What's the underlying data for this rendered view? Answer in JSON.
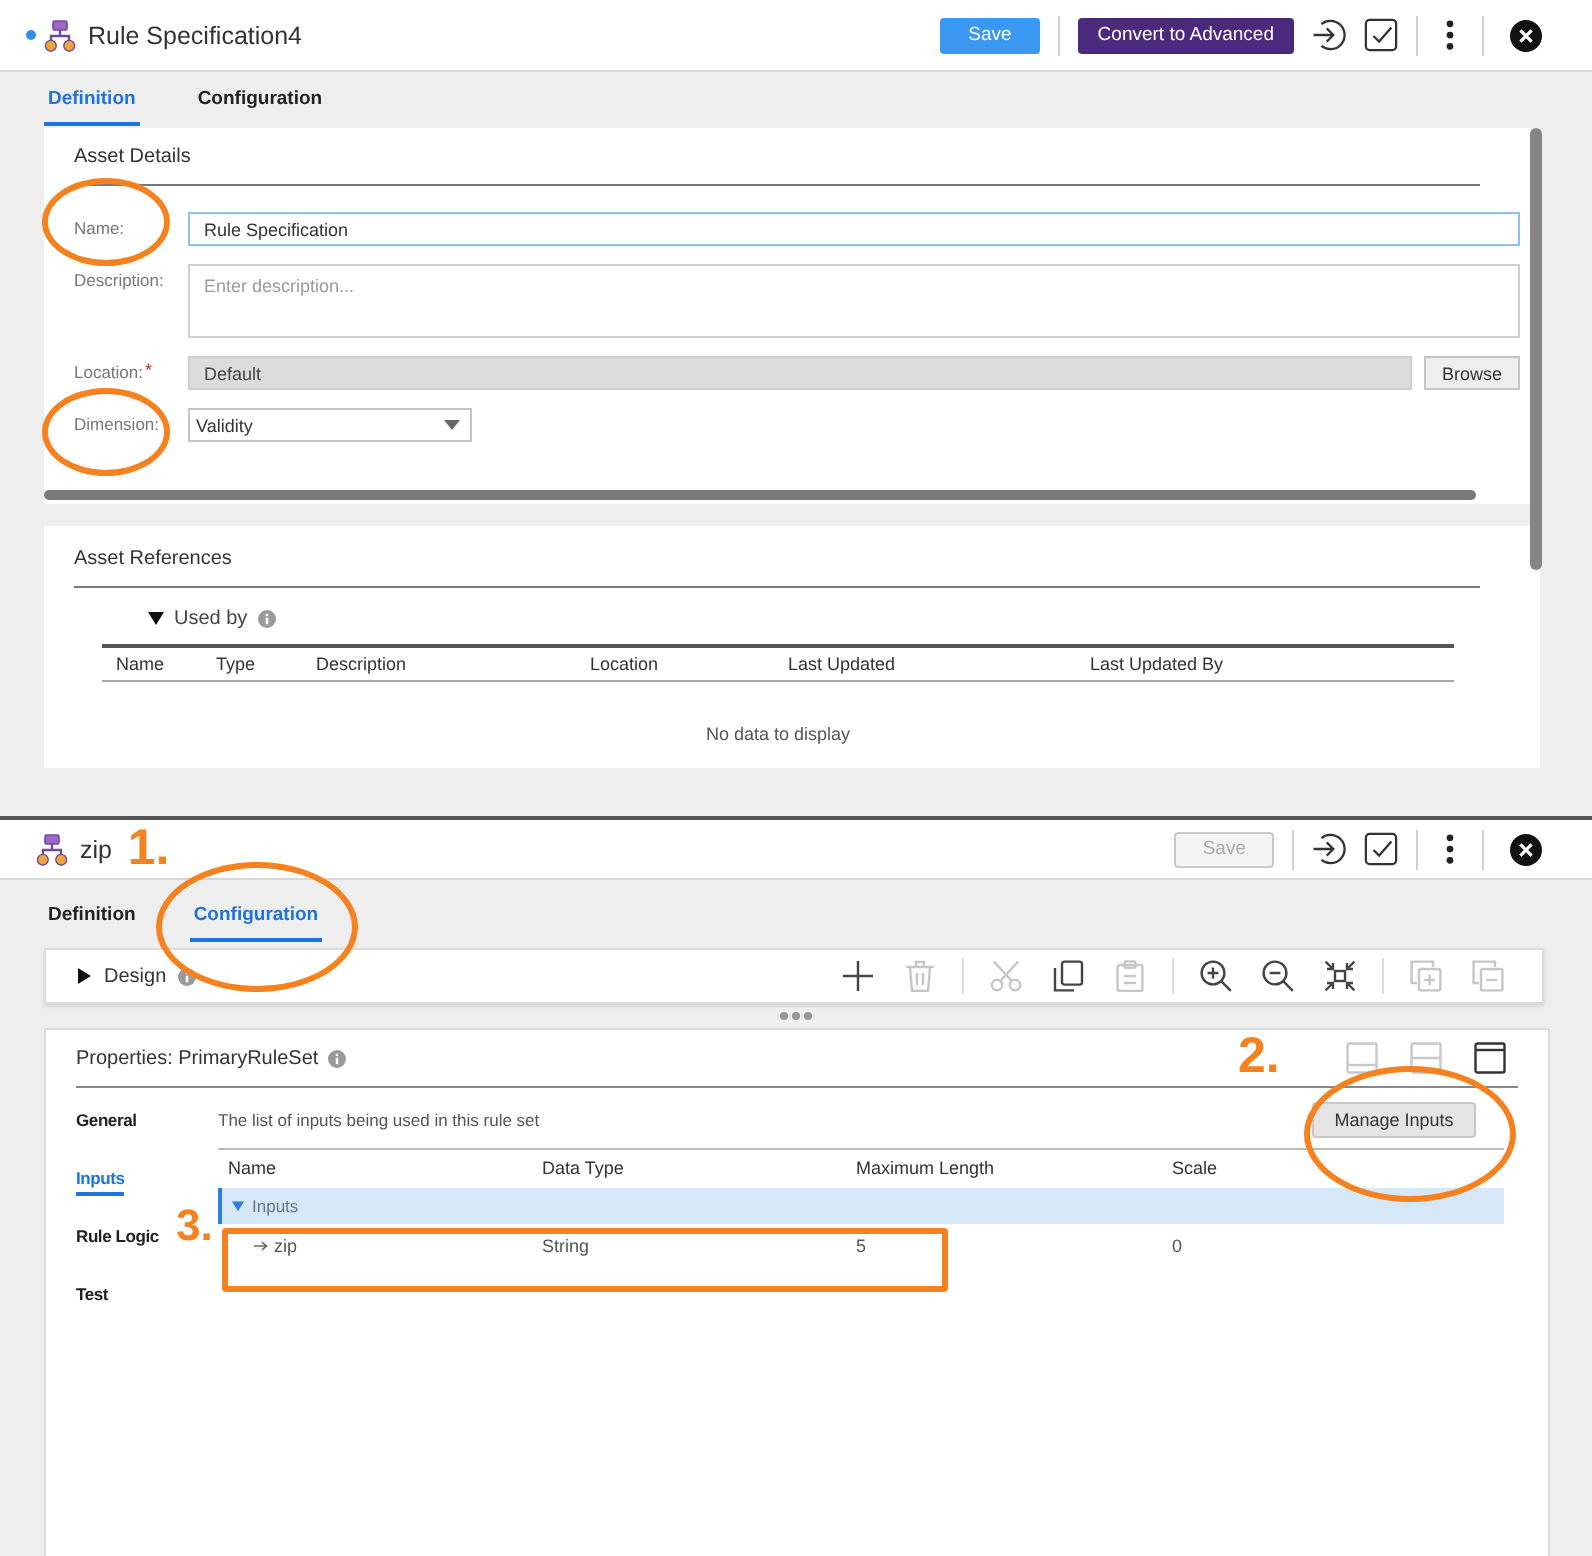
{
  "upper_view": {
    "header": {
      "modified": true,
      "title": "Rule Specification4",
      "buttons": [
        {
          "label": "Save",
          "kind": "save",
          "disabled": false
        },
        {
          "label": "Convert to Advanced",
          "kind": "convert",
          "disabled": false
        }
      ]
    },
    "tabs": [
      {
        "label": "Definition",
        "selected": true
      },
      {
        "label": "Configuration",
        "selected": false
      }
    ],
    "asset_details": {
      "title": "Asset Details",
      "fields": [
        {
          "kind": "text",
          "label": "Name:",
          "value": "Rule Specification",
          "focused": true,
          "circled": true
        },
        {
          "kind": "textarea",
          "label": "Description:",
          "placeholder": "Enter description...",
          "focused": false,
          "circled": false
        },
        {
          "kind": "browse",
          "label": "Location:",
          "required_mark": "*",
          "value": "Default",
          "button": "Browse",
          "focused": false,
          "circled": false
        },
        {
          "kind": "select",
          "label": "Dimension:",
          "value": "Validity",
          "focused": false,
          "circled": true
        }
      ]
    },
    "asset_references": {
      "title": "Asset References",
      "section": {
        "label": "Used by",
        "expanded": true
      },
      "columns": [
        "Name",
        "Type",
        "Description",
        "Location",
        "Last Updated",
        "Last Updated By"
      ],
      "empty_message": "No data to display"
    }
  },
  "lower_view": {
    "header": {
      "modified": false,
      "title": "zip",
      "buttons": [
        {
          "label": "Save",
          "kind": "save",
          "disabled": true
        }
      ]
    },
    "tabs": [
      {
        "label": "Definition",
        "selected": false,
        "circled": false
      },
      {
        "label": "Configuration",
        "selected": true,
        "circled": true,
        "callout": "1."
      }
    ],
    "design": {
      "label": "Design",
      "expanded": false,
      "tool_groups": [
        [
          {
            "kind": "add",
            "disabled": false
          },
          {
            "kind": "delete",
            "disabled": true
          }
        ],
        [
          {
            "kind": "cut",
            "disabled": true
          },
          {
            "kind": "copy",
            "disabled": false
          },
          {
            "kind": "paste",
            "disabled": true
          }
        ],
        [
          {
            "kind": "zoom_in",
            "disabled": false
          },
          {
            "kind": "zoom_out",
            "disabled": false
          },
          {
            "kind": "fit",
            "disabled": false
          }
        ],
        [
          {
            "kind": "expand_all",
            "disabled": true
          },
          {
            "kind": "collapse_all",
            "disabled": true
          }
        ]
      ]
    },
    "properties": {
      "title": "Properties: PrimaryRuleSet",
      "layouts": [
        {
          "kind": "bottom",
          "disabled": true
        },
        {
          "kind": "middle",
          "disabled": true
        },
        {
          "kind": "top",
          "disabled": false
        }
      ],
      "nav": [
        {
          "label": "General",
          "selected": false
        },
        {
          "label": "Inputs",
          "selected": true
        },
        {
          "label": "Rule Logic",
          "selected": false
        },
        {
          "label": "Test",
          "selected": false
        }
      ],
      "description": "The list of inputs being used in this rule set",
      "manage_button": {
        "label": "Manage Inputs",
        "circled": true,
        "callout": "2."
      },
      "table": {
        "columns": [
          "Name",
          "Data Type",
          "Maximum Length",
          "Scale"
        ],
        "groups": [
          {
            "label": "Inputs",
            "expanded": true,
            "rows": [
              {
                "cells": [
                  "zip",
                  "String",
                  "5",
                  "0"
                ],
                "boxed": true,
                "callout": "3."
              }
            ]
          }
        ]
      }
    }
  }
}
